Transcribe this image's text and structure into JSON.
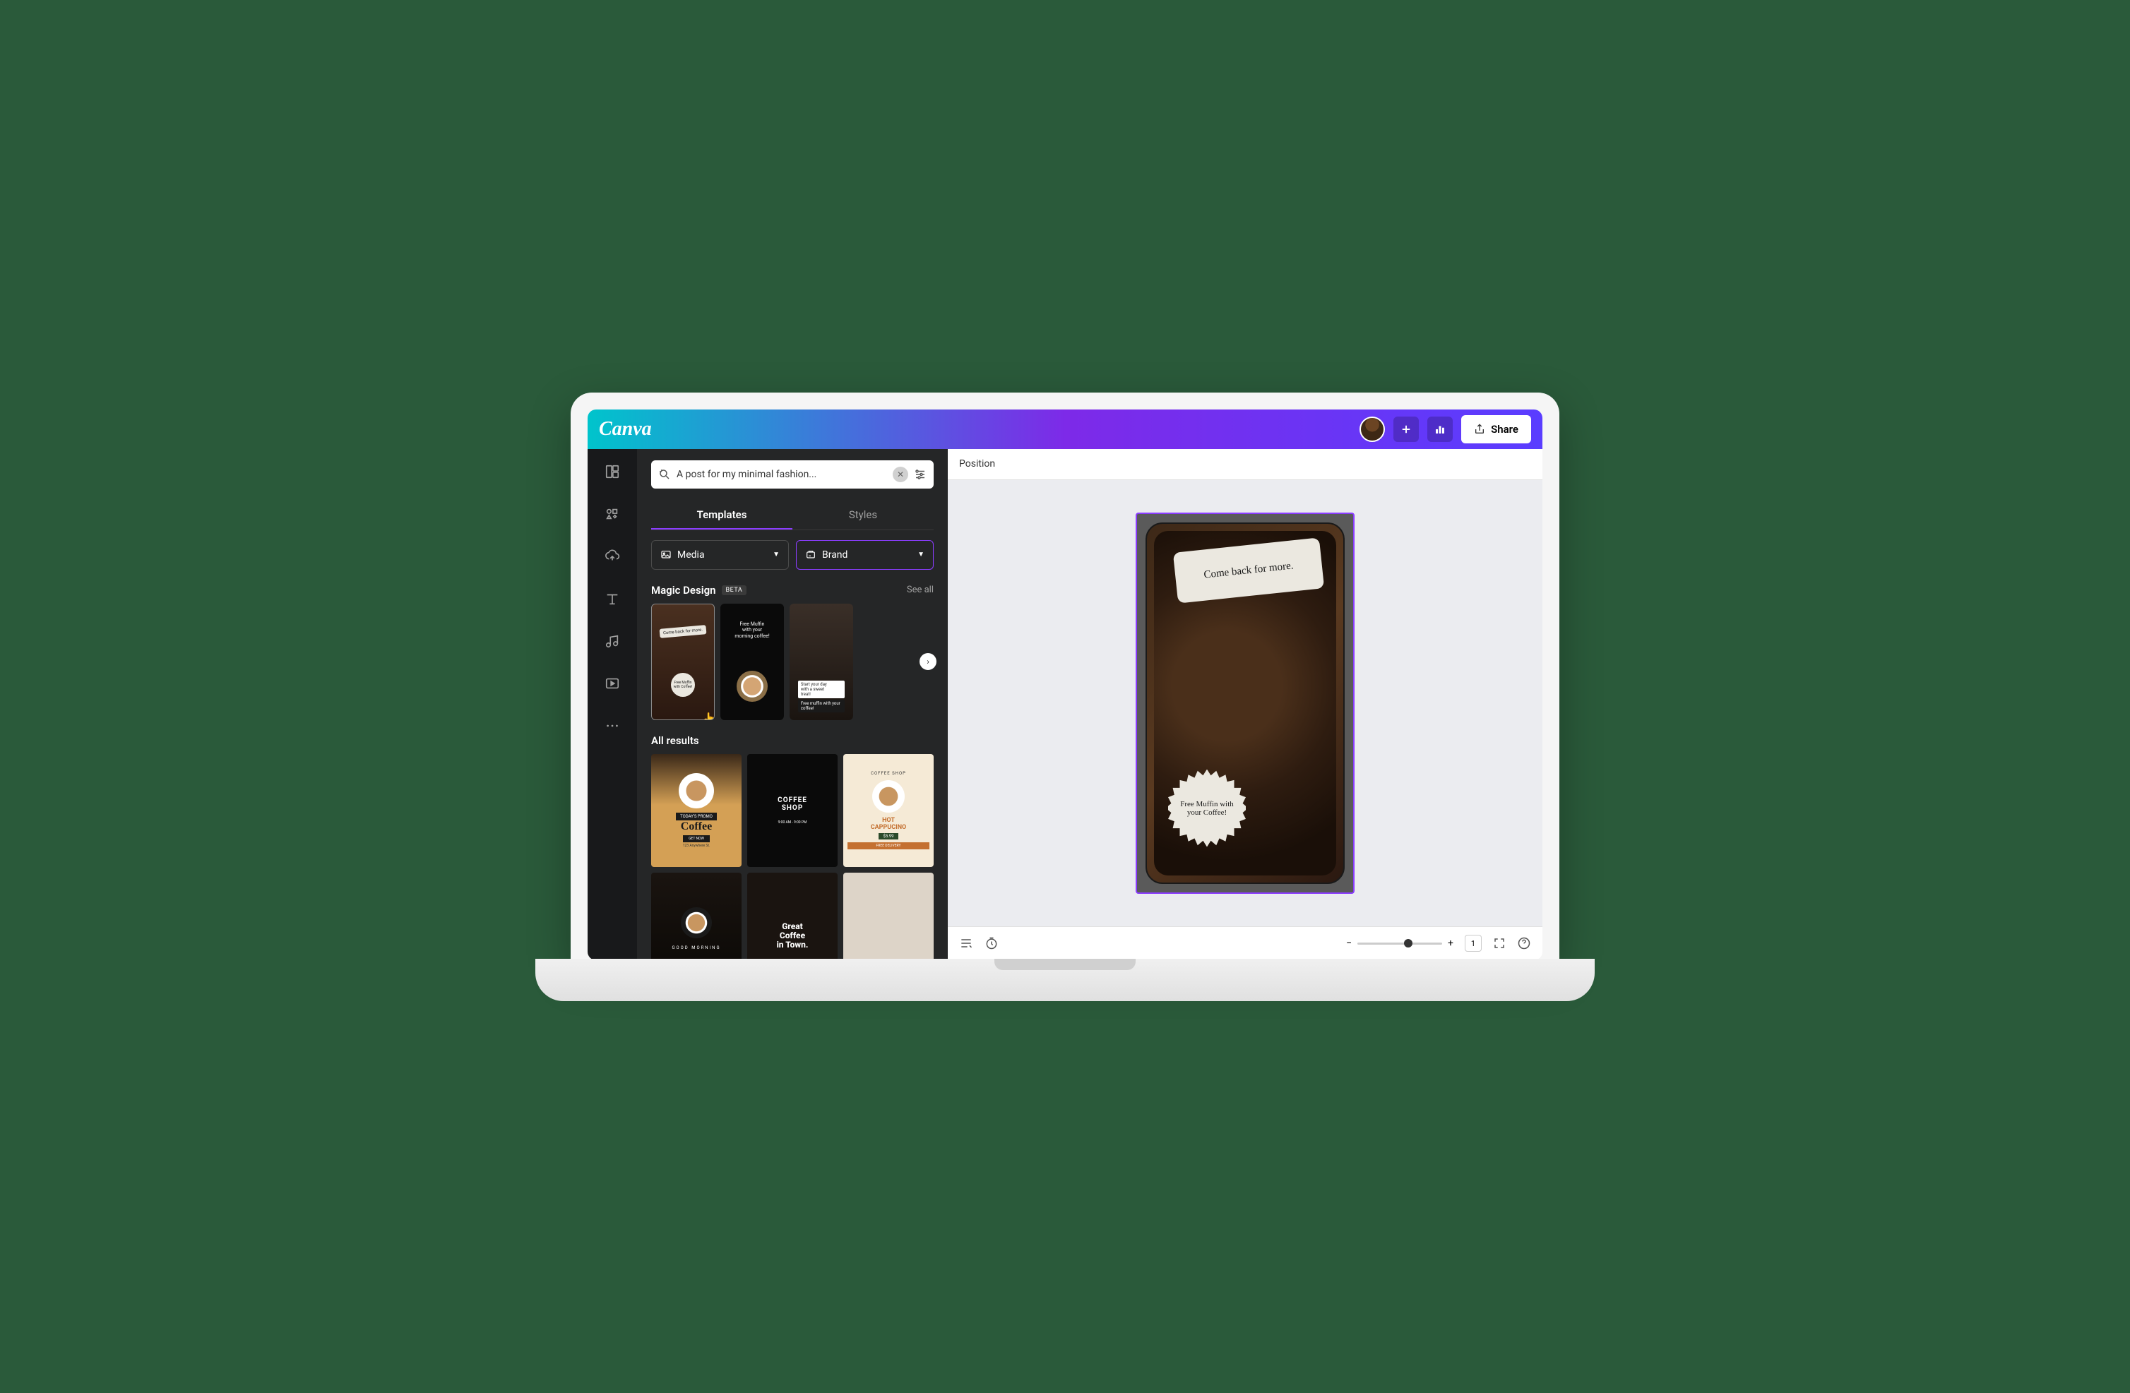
{
  "topbar": {
    "logo": "Canva",
    "share": "Share"
  },
  "search": {
    "value": "A post for my minimal fashion..."
  },
  "tabs": {
    "templates": "Templates",
    "styles": "Styles"
  },
  "filters": {
    "media": "Media",
    "brand": "Brand"
  },
  "magic": {
    "title": "Magic Design",
    "beta": "BETA",
    "see_all": "See all"
  },
  "magic_thumbs": {
    "t1_ticket": "Come back for more.",
    "t1_star": "Free Muffin with Coffee!",
    "t2_line1": "Free Muffin",
    "t2_line2": "with your",
    "t2_line3": "morning coffee!",
    "t3_l1": "Start your day",
    "t3_l2": "with a sweet",
    "t3_l3": "treat!",
    "t3_l4": "Free muffin with your coffee!"
  },
  "all_results": {
    "title": "All results"
  },
  "grid": {
    "g1_promo": "TODAY'S PROMO",
    "g1_title": "Coffee",
    "g1_btn": "GET NOW",
    "g1_addr": "123 Anywhere St.",
    "g2_l1": "COFFEE",
    "g2_l2": "SHOP",
    "g2_hours": "9:00 AM - 9:00 PM",
    "g3_top": "COFFEE SHOP",
    "g3_l1": "HOT",
    "g3_l2": "CAPPUCINO",
    "g3_price": "$5.99",
    "g3_del": "FREE DELIVERY",
    "g4_sub": "GOOD MORNING",
    "g5_l1": "Great",
    "g5_l2": "Coffee",
    "g5_l3": "in Town."
  },
  "canvas": {
    "position": "Position",
    "page": "1"
  },
  "artboard": {
    "ticket": "Come back for more.",
    "star": "Free Muffin with your Coffee!"
  }
}
